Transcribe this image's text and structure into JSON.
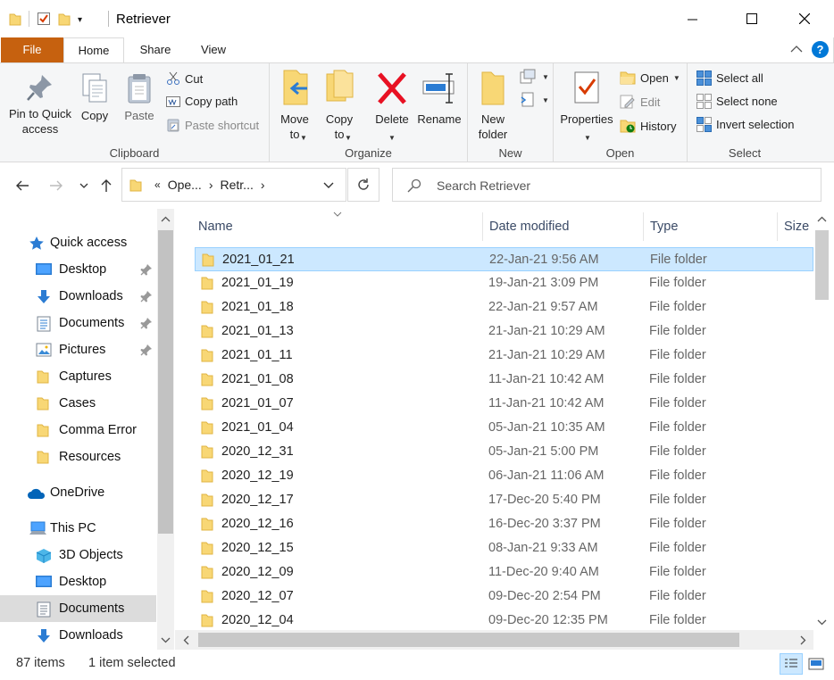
{
  "window": {
    "title": "Retriever"
  },
  "tabs": [
    "File",
    "Home",
    "Share",
    "View"
  ],
  "ribbon": {
    "clipboard": {
      "label": "Clipboard",
      "pin": "Pin to Quick\naccess",
      "copy": "Copy",
      "paste": "Paste",
      "cut": "Cut",
      "copy_path": "Copy path",
      "paste_shortcut": "Paste shortcut"
    },
    "organize": {
      "label": "Organize",
      "move_to": "Move\nto",
      "copy_to": "Copy\nto",
      "delete": "Delete",
      "rename": "Rename"
    },
    "new": {
      "label": "New",
      "new_folder": "New\nfolder"
    },
    "open": {
      "label": "Open",
      "properties": "Properties",
      "open": "Open",
      "edit": "Edit",
      "history": "History"
    },
    "select": {
      "label": "Select",
      "select_all": "Select all",
      "select_none": "Select none",
      "invert": "Invert selection"
    }
  },
  "address": {
    "crumbs": [
      "«",
      "Ope...",
      "›",
      "Retr...",
      "›"
    ]
  },
  "search": {
    "placeholder": "Search Retriever"
  },
  "nav": {
    "items": [
      {
        "label": "Quick access",
        "icon": "star-icon",
        "pinned": false
      },
      {
        "label": "Desktop",
        "icon": "desktop-icon",
        "pinned": true
      },
      {
        "label": "Downloads",
        "icon": "download-icon",
        "pinned": true
      },
      {
        "label": "Documents",
        "icon": "documents-icon",
        "pinned": true
      },
      {
        "label": "Pictures",
        "icon": "pictures-icon",
        "pinned": true
      },
      {
        "label": "Captures",
        "icon": "folder-icon",
        "pinned": false
      },
      {
        "label": "Cases",
        "icon": "folder-icon",
        "pinned": false
      },
      {
        "label": "Comma Error",
        "icon": "folder-icon",
        "pinned": false
      },
      {
        "label": "Resources",
        "icon": "folder-icon",
        "pinned": false
      },
      {
        "label": "OneDrive",
        "icon": "cloud-icon",
        "pinned": false
      },
      {
        "label": "This PC",
        "icon": "pc-icon",
        "pinned": false
      },
      {
        "label": "3D Objects",
        "icon": "cube-icon",
        "pinned": false
      },
      {
        "label": "Desktop",
        "icon": "desktop-icon",
        "pinned": false
      },
      {
        "label": "Documents",
        "icon": "documents-icon",
        "pinned": false
      },
      {
        "label": "Downloads",
        "icon": "download-icon",
        "pinned": false
      }
    ]
  },
  "columns": {
    "name": "Name",
    "date": "Date modified",
    "type": "Type",
    "size": "Size"
  },
  "files": [
    {
      "name": "2021_01_21",
      "date": "22-Jan-21 9:56 AM",
      "type": "File folder",
      "selected": true
    },
    {
      "name": "2021_01_19",
      "date": "19-Jan-21 3:09 PM",
      "type": "File folder"
    },
    {
      "name": "2021_01_18",
      "date": "22-Jan-21 9:57 AM",
      "type": "File folder"
    },
    {
      "name": "2021_01_13",
      "date": "21-Jan-21 10:29 AM",
      "type": "File folder"
    },
    {
      "name": "2021_01_11",
      "date": "21-Jan-21 10:29 AM",
      "type": "File folder"
    },
    {
      "name": "2021_01_08",
      "date": "11-Jan-21 10:42 AM",
      "type": "File folder"
    },
    {
      "name": "2021_01_07",
      "date": "11-Jan-21 10:42 AM",
      "type": "File folder"
    },
    {
      "name": "2021_01_04",
      "date": "05-Jan-21 10:35 AM",
      "type": "File folder"
    },
    {
      "name": "2020_12_31",
      "date": "05-Jan-21 5:00 PM",
      "type": "File folder"
    },
    {
      "name": "2020_12_19",
      "date": "06-Jan-21 11:06 AM",
      "type": "File folder"
    },
    {
      "name": "2020_12_17",
      "date": "17-Dec-20 5:40 PM",
      "type": "File folder"
    },
    {
      "name": "2020_12_16",
      "date": "16-Dec-20 3:37 PM",
      "type": "File folder"
    },
    {
      "name": "2020_12_15",
      "date": "08-Jan-21 9:33 AM",
      "type": "File folder"
    },
    {
      "name": "2020_12_09",
      "date": "11-Dec-20 9:40 AM",
      "type": "File folder"
    },
    {
      "name": "2020_12_07",
      "date": "09-Dec-20 2:54 PM",
      "type": "File folder"
    },
    {
      "name": "2020_12_04",
      "date": "09-Dec-20 12:35 PM",
      "type": "File folder"
    }
  ],
  "status": {
    "count": "87 items",
    "selected": "1 item selected"
  },
  "colors": {
    "file_tab": "#c6610f",
    "selection": "#cce8ff",
    "folder": "#f8d775",
    "accent": "#0078d7"
  }
}
